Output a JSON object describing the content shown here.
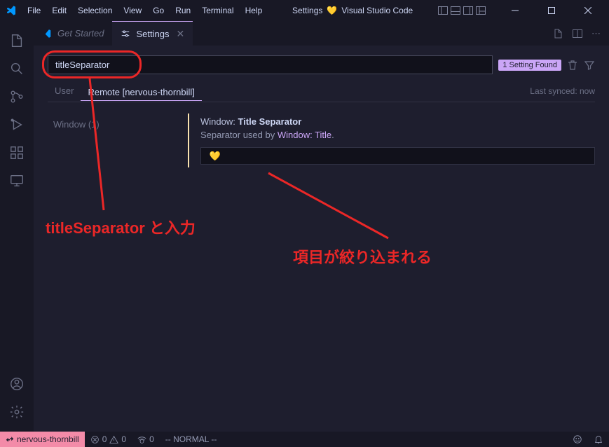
{
  "menu": [
    "File",
    "Edit",
    "Selection",
    "View",
    "Go",
    "Run",
    "Terminal",
    "Help"
  ],
  "window_title_prefix": "Settings",
  "window_title_suffix": "Visual Studio Code",
  "tabs": {
    "get_started": "Get Started",
    "settings": "Settings"
  },
  "settings": {
    "search_value": "titleSeparator",
    "found_badge": "1 Setting Found",
    "scope_user": "User",
    "scope_remote": "Remote [nervous-thornbill]",
    "sync": "Last synced: now",
    "toc_window": "Window (1)",
    "item": {
      "category": "Window:",
      "name": "Title Separator",
      "desc_prefix": "Separator used by ",
      "desc_link": "Window: Title",
      "desc_suffix": ".",
      "value": " 💛 "
    }
  },
  "status": {
    "remote": "nervous-thornbill",
    "errors": "0",
    "warnings": "0",
    "ports": "0",
    "mode": "-- NORMAL --"
  },
  "annotations": {
    "input": "titleSeparator と入力",
    "filtered": "項目が絞り込まれる"
  }
}
